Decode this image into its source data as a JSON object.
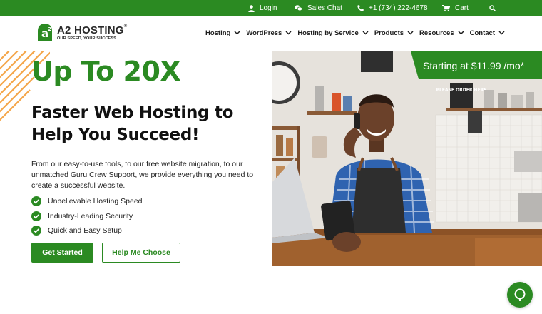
{
  "topbar": {
    "login": "Login",
    "sales_chat": "Sales Chat",
    "phone": "+1 (734) 222-4678",
    "cart": "Cart"
  },
  "logo": {
    "brand": "A2 HOSTING",
    "tagline": "OUR SPEED, YOUR SUCCESS"
  },
  "nav": {
    "items": [
      {
        "label": "Hosting"
      },
      {
        "label": "WordPress"
      },
      {
        "label": "Hosting by Service"
      },
      {
        "label": "Products"
      },
      {
        "label": "Resources"
      },
      {
        "label": "Contact"
      }
    ]
  },
  "hero": {
    "headline_accent": "Up To 20X",
    "headline_main": "Faster Web Hosting to Help You Succeed!",
    "description": "From our easy-to-use tools, to our free website migration, to our unmatched Guru Crew Support, we provide everything you need to create a successful website.",
    "features": [
      "Unbelievable Hosting Speed",
      "Industry-Leading Security",
      "Quick and Easy Setup"
    ],
    "primary_button": "Get Started",
    "secondary_button": "Help Me Choose",
    "price_badge": "Starting at $11.99 /mo*"
  },
  "photo": {
    "board_text": "PLEASE ORDER HERE"
  },
  "colors": {
    "brand_green": "#2b8a22",
    "stripe_orange": "#f4a64a"
  },
  "icons": {
    "login": "user-icon",
    "sales_chat": "chat-bubbles-icon",
    "phone": "phone-icon",
    "cart": "cart-icon",
    "search": "search-icon",
    "chat_widget": "chat-icon",
    "feature": "check-circle-icon"
  }
}
